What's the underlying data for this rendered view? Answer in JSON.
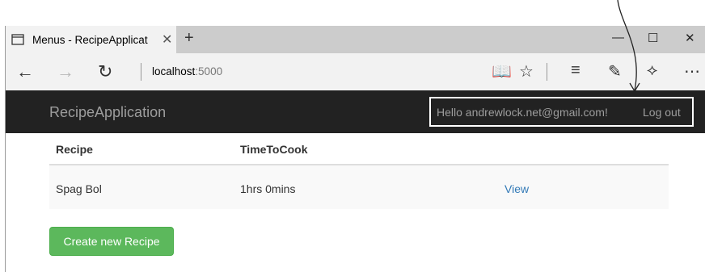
{
  "browser": {
    "tab_title": "Menus - RecipeApplicat",
    "tab_close": "✕",
    "new_tab": "+",
    "address_host": "localhost",
    "address_port": ":5000",
    "window_controls": {
      "minimize": "—",
      "maximize": "☐",
      "close": "✕"
    }
  },
  "site": {
    "brand": "RecipeApplication",
    "greeting": "Hello andrewlock.net@gmail.com!",
    "logout": "Log out"
  },
  "table": {
    "headers": [
      "Recipe",
      "TimeToCook"
    ],
    "rows": [
      {
        "recipe": "Spag Bol",
        "time": "1hrs 0mins",
        "action": "View"
      }
    ]
  },
  "create_button": "Create new Recipe",
  "colors": {
    "navbar": "#222222",
    "success": "#5cb85c",
    "link": "#337ab7"
  }
}
